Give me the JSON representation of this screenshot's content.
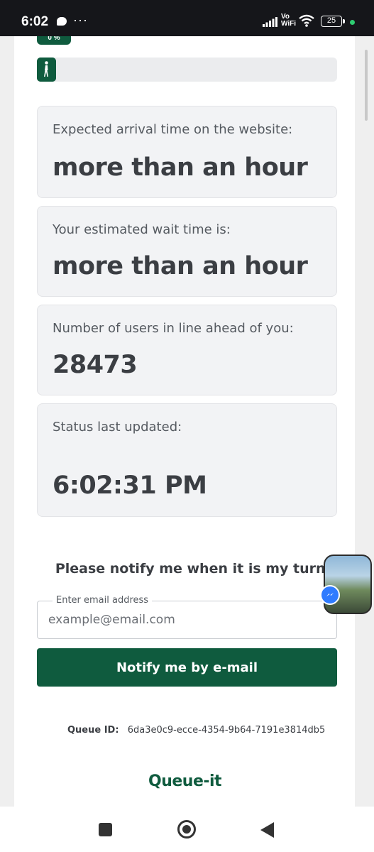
{
  "status_bar": {
    "time": "6:02",
    "more_indicator": "···",
    "network_label": "Vo\nWiFi",
    "battery_level": "25",
    "icons": [
      "message-bubble-icon",
      "signal-icon",
      "wifi-icon",
      "battery-icon"
    ]
  },
  "queue": {
    "progress_percent_label": "0 %",
    "progress_fraction": 0.0
  },
  "cards": [
    {
      "label": "Expected arrival time on the website:",
      "value": "more than an hour"
    },
    {
      "label": "Your estimated wait time is:",
      "value": "more than an hour"
    },
    {
      "label": "Number of users in line ahead of you:",
      "value": "28473"
    },
    {
      "label": "Status last updated:",
      "value": "6:02:31 PM"
    }
  ],
  "notify": {
    "title": "Please notify me when it is my turn:",
    "email_legend": "Enter email address",
    "email_placeholder": "example@email.com",
    "button_label": "Notify me by e-mail"
  },
  "footer": {
    "queue_id_label": "Queue ID:",
    "queue_id_value": "6da3e0c9-ecce-4354-9b64-7191e3814db5",
    "brand": "Queue-it"
  },
  "colors": {
    "brand_green": "#0f5b3e",
    "card_bg": "#f2f3f5",
    "text_dark": "#3b3e43"
  }
}
